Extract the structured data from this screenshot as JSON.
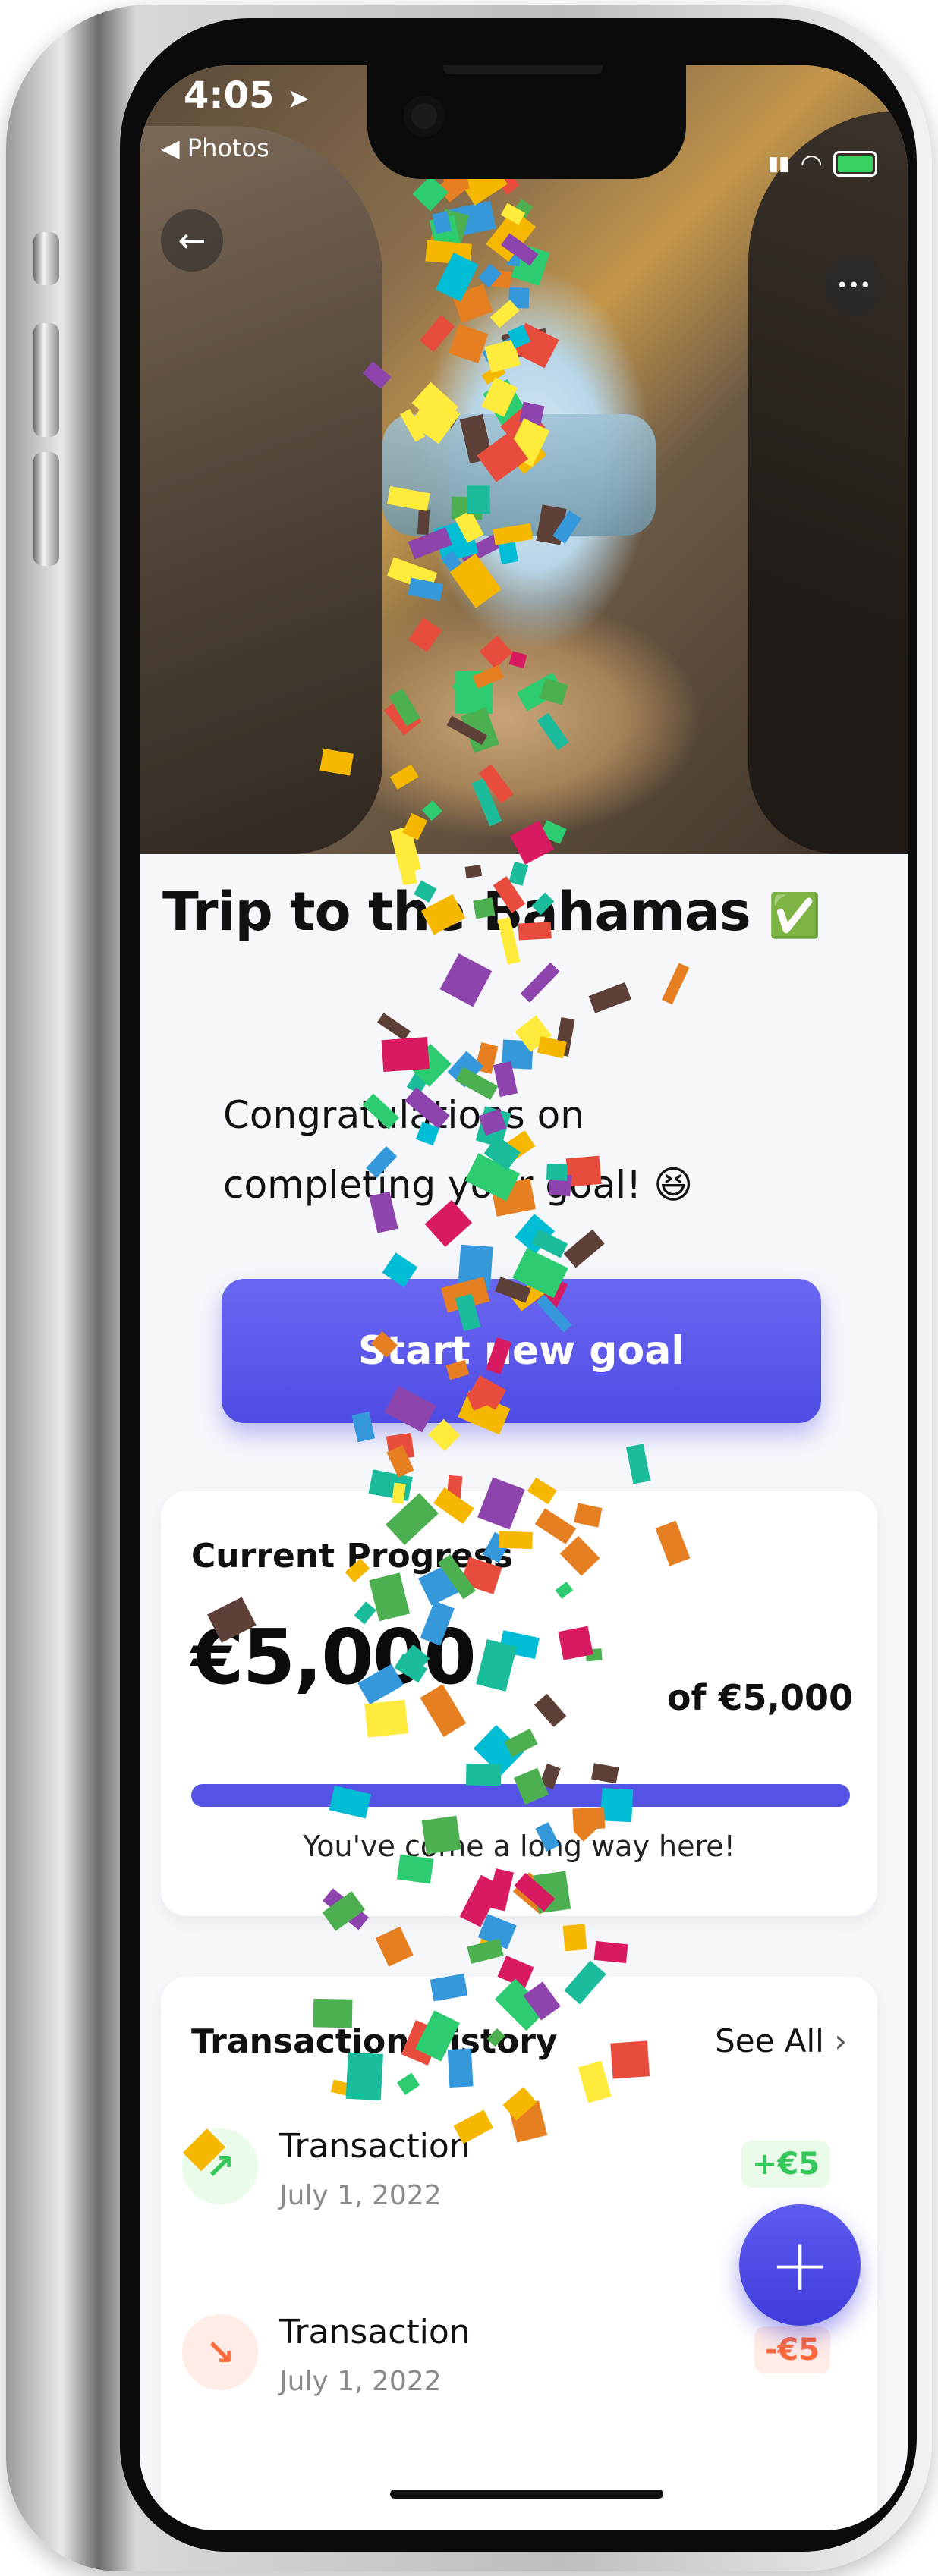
{
  "status_bar": {
    "time": "4:05",
    "back_app": "◀ Photos",
    "location_icon": "location-arrow-icon",
    "signal_icon": "signal-icon",
    "wifi_icon": "wifi-icon",
    "battery_icon": "battery-charging-icon"
  },
  "header": {
    "back_icon": "arrow-left-icon",
    "back_glyph": "←",
    "more_icon": "more-horizontal-icon",
    "more_glyph": "•••"
  },
  "goal": {
    "title": "Trip to the Bahamas",
    "title_badge": "✅",
    "message": "Congratulations on completing your goal!",
    "message_emoji": "😆",
    "cta_label": "Start new goal"
  },
  "progress_card": {
    "label": "Current Progress",
    "amount": "€5,000",
    "target": "of €5,000",
    "progress_fraction": 1.0,
    "message": "You've come a long way here!",
    "accent_color": "#5552e6"
  },
  "transactions": {
    "title": "Transaction History",
    "see_all": "See All",
    "see_all_icon": "chevron-right-icon",
    "items": [
      {
        "title": "Transaction",
        "date": "July 1, 2022",
        "amount": "+€5",
        "direction": "in",
        "icon": "trend-up-icon",
        "glyph": "↗",
        "color": "#34c759"
      },
      {
        "title": "Transaction",
        "date": "July 1, 2022",
        "amount": "-€5",
        "direction": "out",
        "icon": "trend-down-icon",
        "glyph": "↘",
        "color": "#ff6a3d"
      }
    ]
  },
  "fab": {
    "icon": "plus-icon",
    "glyph": "+"
  }
}
